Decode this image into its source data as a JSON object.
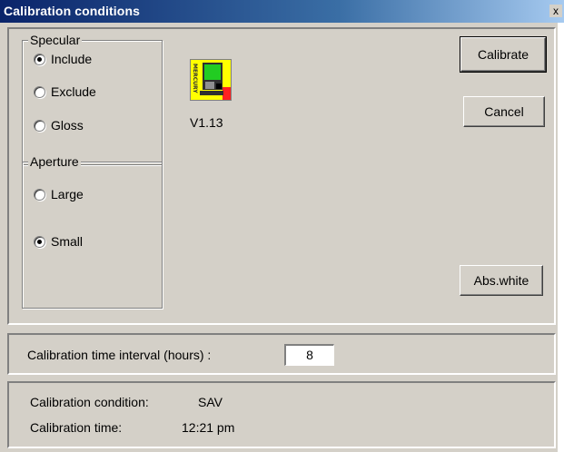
{
  "window": {
    "title": "Calibration conditions",
    "close_glyph": "x"
  },
  "specular": {
    "legend": "Specular",
    "options": [
      {
        "label": "Include",
        "checked": true
      },
      {
        "label": "Exclude",
        "checked": false
      },
      {
        "label": "Gloss",
        "checked": false
      }
    ]
  },
  "aperture": {
    "legend": "Aperture",
    "options": [
      {
        "label": "Large",
        "checked": false
      },
      {
        "label": "Small",
        "checked": true
      }
    ]
  },
  "app": {
    "icon": "mercury-icon",
    "icon_text": "MERCURY",
    "version": "V1.13"
  },
  "buttons": {
    "calibrate": "Calibrate",
    "cancel": "Cancel",
    "abs_white": "Abs.white"
  },
  "interval": {
    "label": "Calibration time interval (hours) :",
    "value": "8"
  },
  "status": {
    "condition_label": "Calibration condition:",
    "condition_value": "SAV",
    "time_label": "Calibration time:",
    "time_value": "12:21 pm"
  },
  "colors": {
    "titlebar": "#0a246a",
    "face": "#d4d0c8",
    "icon_bg": "#ffff00",
    "icon_screen": "#22cc22"
  }
}
